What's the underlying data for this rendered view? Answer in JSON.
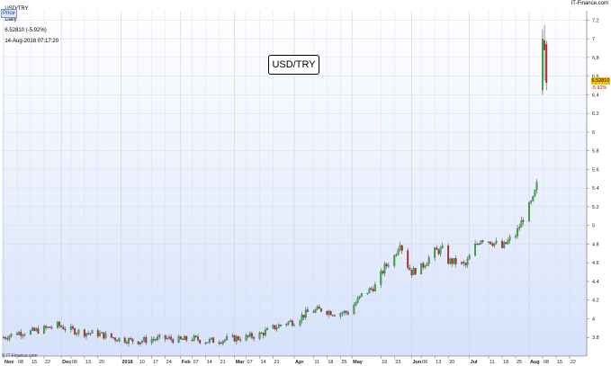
{
  "header": {
    "symbol": "USD/TRY",
    "interval": "Daily",
    "price_text": "6.52810 (-5.92%)",
    "timestamp": "14-Aug-2018 07:17:20",
    "brand": "IT-Finance.com",
    "copyright": "© IT-Finance.com",
    "legend_label": "Price"
  },
  "last_price": {
    "value": "6.52810",
    "change": "-5.92%"
  },
  "colors": {
    "up": "#2fbf2f",
    "down": "#d22727",
    "wick": "#333333",
    "grid": "#d5dbe6",
    "bg_top": "#ffffff",
    "bg_bottom": "#d6e2fb"
  },
  "chart_data": {
    "type": "candlestick",
    "title": "USD/TRY",
    "ylim": [
      3.6,
      7.3
    ],
    "y_ticks": [
      3.8,
      4,
      4.2,
      4.4,
      4.6,
      4.8,
      5,
      5.2,
      5.4,
      5.6,
      5.8,
      6,
      6.2,
      6.4,
      6.6,
      6.8,
      7,
      7.2
    ],
    "y_tick_labels": [
      "3.8",
      "4",
      "4.2",
      "4.4",
      "4.6",
      "4.8",
      "5",
      "5.2",
      "5.4",
      "5.6",
      "5.8",
      "6",
      "6.2",
      "6.4",
      "6.6",
      "6.8",
      "7",
      "7.2"
    ],
    "x_ticks": [
      {
        "label": "Nov",
        "day": 0,
        "major": true
      },
      {
        "label": "08",
        "day": 7
      },
      {
        "label": "15",
        "day": 14
      },
      {
        "label": "22",
        "day": 21
      },
      {
        "label": "Dec",
        "day": 30,
        "major": true
      },
      {
        "label": "06",
        "day": 35
      },
      {
        "label": "13",
        "day": 42
      },
      {
        "label": "20",
        "day": 49
      },
      {
        "label": "2018",
        "day": 61,
        "major": true
      },
      {
        "label": "10",
        "day": 70
      },
      {
        "label": "17",
        "day": 77
      },
      {
        "label": "24",
        "day": 84
      },
      {
        "label": "Feb",
        "day": 92,
        "major": true
      },
      {
        "label": "07",
        "day": 98
      },
      {
        "label": "14",
        "day": 105
      },
      {
        "label": "21",
        "day": 112
      },
      {
        "label": "Mar",
        "day": 120,
        "major": true
      },
      {
        "label": "07",
        "day": 126
      },
      {
        "label": "14",
        "day": 133
      },
      {
        "label": "21",
        "day": 140
      },
      {
        "label": "Apr",
        "day": 151,
        "major": true
      },
      {
        "label": "11",
        "day": 161
      },
      {
        "label": "18",
        "day": 168
      },
      {
        "label": "25",
        "day": 175
      },
      {
        "label": "May",
        "day": 181,
        "major": true
      },
      {
        "label": "16",
        "day": 196
      },
      {
        "label": "23",
        "day": 203
      },
      {
        "label": "Jun",
        "day": 212,
        "major": true
      },
      {
        "label": "06",
        "day": 217
      },
      {
        "label": "13",
        "day": 224
      },
      {
        "label": "20",
        "day": 231
      },
      {
        "label": "Jul",
        "day": 242,
        "major": true
      },
      {
        "label": "11",
        "day": 252
      },
      {
        "label": "18",
        "day": 259
      },
      {
        "label": "25",
        "day": 266
      },
      {
        "label": "Aug",
        "day": 273,
        "major": true
      },
      {
        "label": "08",
        "day": 280
      },
      {
        "label": "15",
        "day": 287
      },
      {
        "label": "22",
        "day": 294
      }
    ],
    "x_range_days": [
      0,
      302
    ],
    "close_path": [
      [
        0,
        3.8
      ],
      [
        7,
        3.85
      ],
      [
        14,
        3.86
      ],
      [
        21,
        3.89
      ],
      [
        28,
        3.93
      ],
      [
        35,
        3.88
      ],
      [
        42,
        3.85
      ],
      [
        49,
        3.84
      ],
      [
        56,
        3.8
      ],
      [
        61,
        3.78
      ],
      [
        70,
        3.76
      ],
      [
        77,
        3.78
      ],
      [
        84,
        3.79
      ],
      [
        92,
        3.77
      ],
      [
        98,
        3.79
      ],
      [
        105,
        3.76
      ],
      [
        112,
        3.77
      ],
      [
        120,
        3.79
      ],
      [
        126,
        3.8
      ],
      [
        133,
        3.83
      ],
      [
        140,
        3.9
      ],
      [
        147,
        3.96
      ],
      [
        151,
        3.97
      ],
      [
        158,
        4.07
      ],
      [
        165,
        4.1
      ],
      [
        172,
        4.06
      ],
      [
        179,
        4.07
      ],
      [
        186,
        4.25
      ],
      [
        193,
        4.35
      ],
      [
        198,
        4.55
      ],
      [
        203,
        4.67
      ],
      [
        206,
        4.83
      ],
      [
        209,
        4.6
      ],
      [
        212,
        4.5
      ],
      [
        217,
        4.55
      ],
      [
        221,
        4.65
      ],
      [
        224,
        4.72
      ],
      [
        228,
        4.74
      ],
      [
        231,
        4.62
      ],
      [
        236,
        4.6
      ],
      [
        240,
        4.57
      ],
      [
        244,
        4.75
      ],
      [
        248,
        4.86
      ],
      [
        252,
        4.84
      ],
      [
        256,
        4.8
      ],
      [
        259,
        4.76
      ],
      [
        263,
        4.85
      ],
      [
        266,
        4.9
      ],
      [
        270,
        5.08
      ],
      [
        273,
        5.2
      ],
      [
        275,
        5.27
      ],
      [
        277,
        5.43
      ],
      [
        278,
        5.75
      ],
      [
        279,
        6.4
      ],
      [
        280,
        6.95
      ],
      [
        281,
        6.88
      ],
      [
        282,
        6.53
      ]
    ],
    "candles_explicit": [
      {
        "day": 279,
        "o": 5.75,
        "h": 6.6,
        "l": 5.72,
        "c": 6.42
      },
      {
        "day": 280,
        "o": 6.45,
        "h": 7.1,
        "l": 6.4,
        "c": 7.0
      },
      {
        "day": 281,
        "o": 6.98,
        "h": 7.15,
        "l": 6.55,
        "c": 6.88
      },
      {
        "day": 282,
        "o": 6.94,
        "h": 6.98,
        "l": 6.45,
        "c": 6.53
      }
    ]
  }
}
